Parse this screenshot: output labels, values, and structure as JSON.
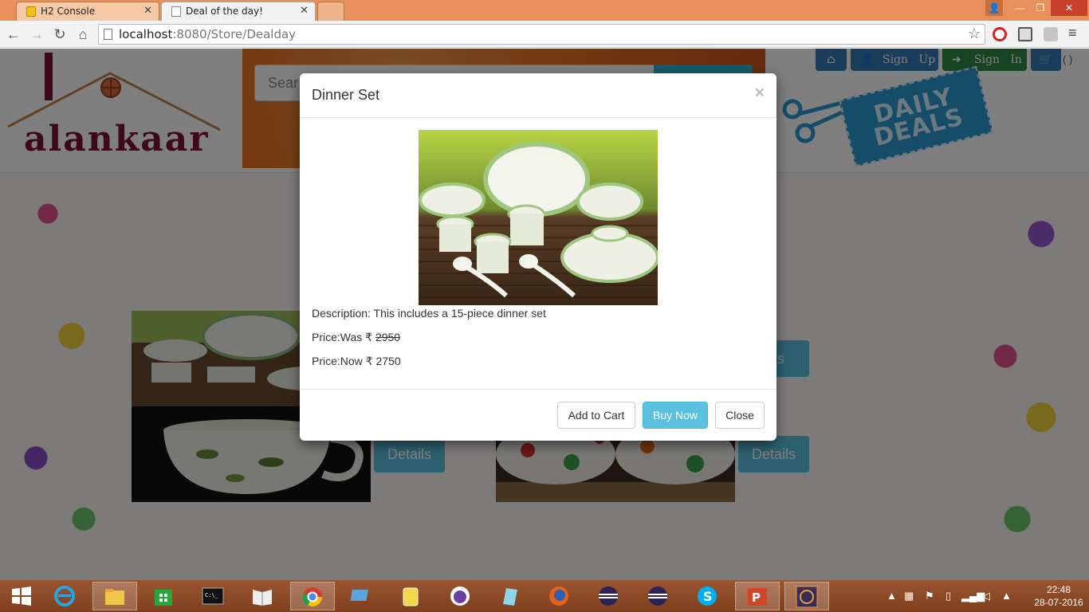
{
  "browser": {
    "tabs": [
      {
        "title": "H2 Console"
      },
      {
        "title": "Deal of the day!"
      }
    ],
    "url_host": "localhost",
    "url_path": ":8080/Store/Dealday"
  },
  "site": {
    "logo": "alankaar",
    "search_placeholder": "Sear",
    "nav": {
      "signup": "Sign   Up",
      "signin": "Sign   In",
      "cart_count": "( )"
    },
    "tag_line1": "DAILY",
    "tag_line2": "DEALS",
    "details_label": "Details",
    "details_partial": "ails"
  },
  "modal": {
    "title": "Dinner Set",
    "close_x": "×",
    "description": "Description: This includes a 15-piece dinner set",
    "price_was_label": "Price:Was ₹ ",
    "price_was_value": "2950",
    "price_now": "Price:Now ₹ 2750",
    "buttons": {
      "add_to_cart": "Add to Cart",
      "buy_now": "Buy Now",
      "close": "Close"
    }
  },
  "taskbar": {
    "time": "22:48",
    "date": "28-07-2016"
  }
}
